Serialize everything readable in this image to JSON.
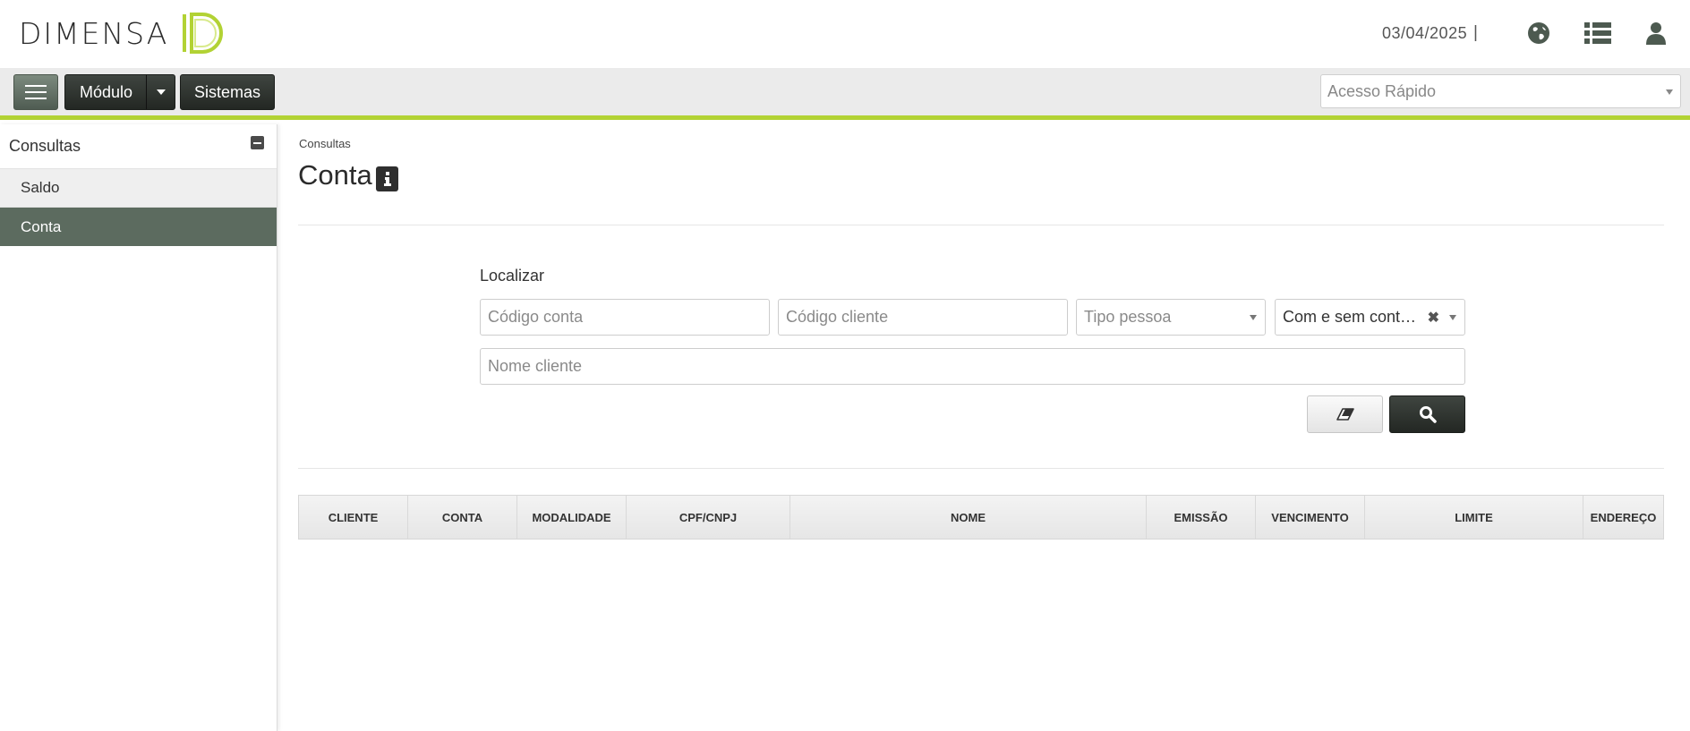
{
  "header": {
    "logo_text": "DIMENSA",
    "date": "03/04/2025",
    "separator": "|",
    "icons": [
      "globe-icon",
      "list-icon",
      "user-icon"
    ]
  },
  "toolbar": {
    "modulo_label": "Módulo",
    "sistemas_label": "Sistemas",
    "quick_access_placeholder": "Acesso Rápido"
  },
  "sidebar": {
    "title": "Consultas",
    "items": [
      {
        "label": "Saldo",
        "active": false
      },
      {
        "label": "Conta",
        "active": true
      }
    ]
  },
  "page": {
    "breadcrumb": "Consultas",
    "title": "Conta"
  },
  "search": {
    "label": "Localizar",
    "codigo_conta_placeholder": "Código conta",
    "codigo_cliente_placeholder": "Código cliente",
    "tipo_pessoa_placeholder": "Tipo pessoa",
    "contrato_value": "Com e sem cont…",
    "nome_cliente_placeholder": "Nome cliente"
  },
  "table": {
    "columns": [
      "CLIENTE",
      "CONTA",
      "MODALIDADE",
      "CPF/CNPJ",
      "NOME",
      "EMISSÃO",
      "VENCIMENTO",
      "LIMITE",
      "ENDEREÇO"
    ]
  },
  "colors": {
    "accent": "#b2d234",
    "dark_button": "#2f352f",
    "sidebar_active": "#5c6b5f"
  }
}
